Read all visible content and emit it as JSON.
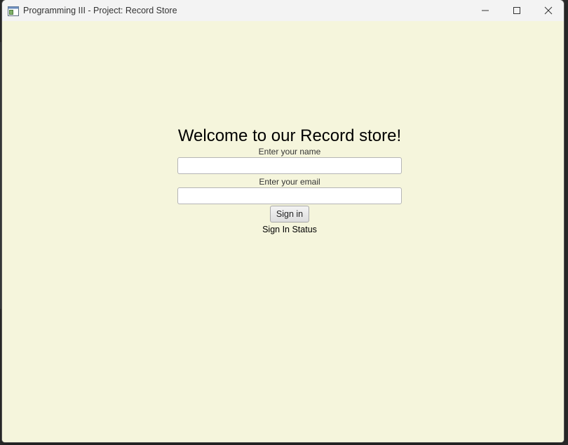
{
  "window": {
    "title": "Programming III - Project: Record Store"
  },
  "form": {
    "heading": "Welcome to our Record store!",
    "name_label": "Enter your name",
    "name_value": "",
    "email_label": "Enter your email",
    "email_value": "",
    "signin_label": "Sign in",
    "status_text": "Sign In Status"
  },
  "icons": {
    "app": "app-window-icon",
    "minimize": "minimize-icon",
    "maximize": "maximize-icon",
    "close": "close-icon"
  },
  "colors": {
    "content_background": "#f5f5dc",
    "titlebar": "#f3f3f3"
  }
}
